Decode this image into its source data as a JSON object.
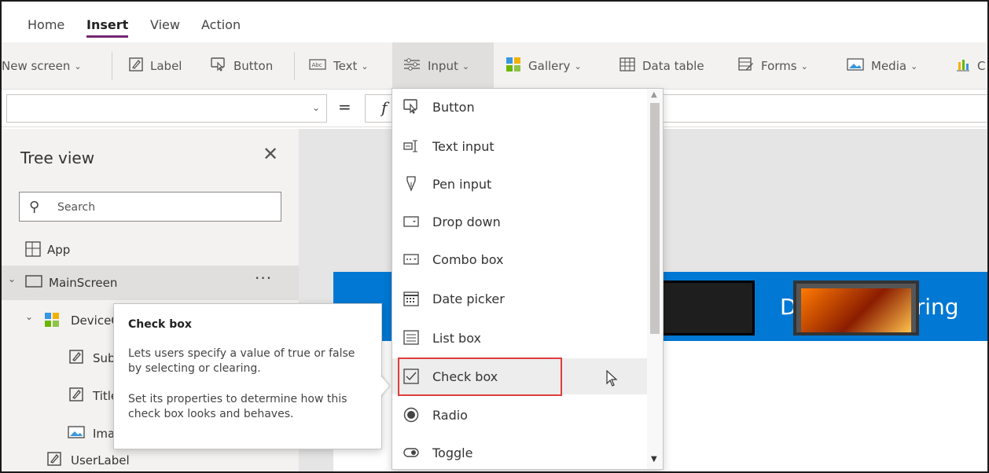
{
  "tabs": [
    "Home",
    "Insert",
    "View",
    "Action"
  ],
  "toolbar": {
    "new_screen": "New screen",
    "label": "Label",
    "button": "Button",
    "text": "Text",
    "input": "Input",
    "gallery": "Gallery",
    "data_table": "Data table",
    "forms": "Forms",
    "media": "Media",
    "charts_partial": "C"
  },
  "formula": {
    "eq": "=",
    "fx": "f"
  },
  "tree": {
    "title": "Tree view",
    "search_placeholder": "Search",
    "items": {
      "app": "App",
      "main_screen": "MainScreen",
      "device_gallery": "DeviceG",
      "subtitle": "Sub",
      "title": "Title",
      "image": "Ima",
      "user_label": "UserLabel"
    },
    "more": "···"
  },
  "canvas": {
    "app_title": "Device Ordering"
  },
  "dropdown": {
    "items": [
      "Button",
      "Text input",
      "Pen input",
      "Drop down",
      "Combo box",
      "Date picker",
      "List box",
      "Check box",
      "Radio",
      "Toggle"
    ],
    "selected": "Check box"
  },
  "tooltip": {
    "title": "Check box",
    "description": "Lets users specify a value of true or false by selecting or clearing.",
    "hint": "Set its properties to determine how this check box looks and behaves."
  },
  "colors": {
    "accent": "#742774",
    "header_blue": "#0078d4",
    "highlight_red": "#e03c3c"
  }
}
